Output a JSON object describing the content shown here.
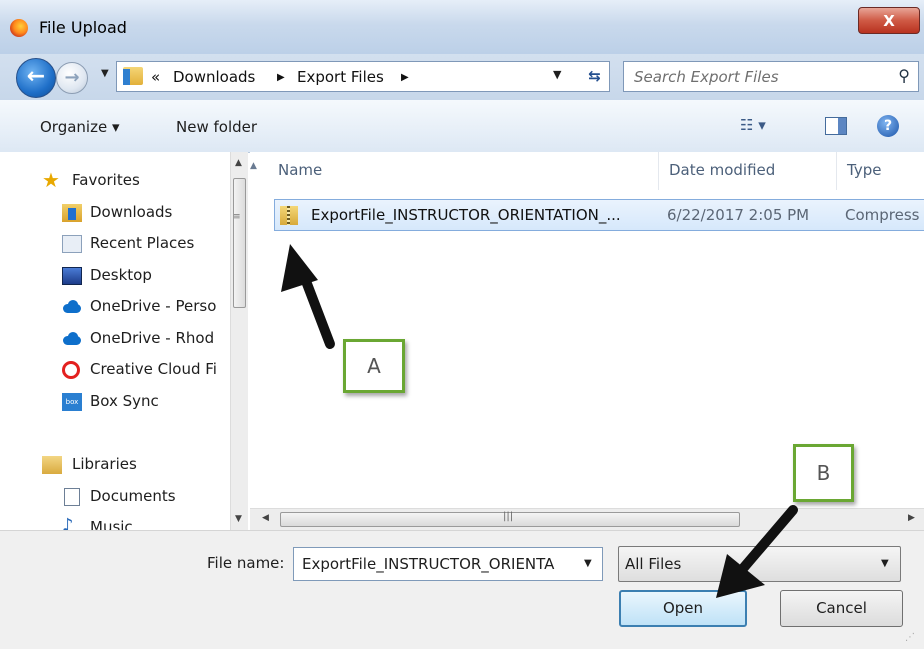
{
  "window": {
    "title": "File Upload",
    "close_label": "X"
  },
  "nav": {
    "back_icon": "back-arrow-icon",
    "forward_icon": "forward-arrow-icon",
    "breadcrumb_overflow": "«",
    "breadcrumb": [
      "Downloads",
      "Export Files"
    ],
    "search_placeholder": "Search Export Files"
  },
  "toolbar": {
    "organize_label": "Organize ▾",
    "new_folder_label": "New folder"
  },
  "sidebar": {
    "favorites_label": "Favorites",
    "items": [
      {
        "label": "Downloads",
        "icon": "downloads-folder-icon"
      },
      {
        "label": "Recent Places",
        "icon": "recent-places-icon"
      },
      {
        "label": "Desktop",
        "icon": "desktop-icon"
      },
      {
        "label": "OneDrive - Perso",
        "icon": "onedrive-cloud-icon"
      },
      {
        "label": "OneDrive - Rhod",
        "icon": "onedrive-cloud-icon"
      },
      {
        "label": "Creative Cloud Fi",
        "icon": "creative-cloud-icon"
      },
      {
        "label": "Box Sync",
        "icon": "box-icon"
      }
    ],
    "libraries_label": "Libraries",
    "library_items": [
      {
        "label": "Documents",
        "icon": "document-icon"
      },
      {
        "label": "Music",
        "icon": "music-note-icon"
      }
    ],
    "box_icon_text": "box"
  },
  "file_list": {
    "columns": [
      "Name",
      "Date modified",
      "Type"
    ],
    "rows": [
      {
        "name": "ExportFile_INSTRUCTOR_ORIENTATION_...",
        "date": "6/22/2017 2:05 PM",
        "type": "Compress"
      }
    ]
  },
  "footer": {
    "file_name_label": "File name:",
    "file_name_value": "ExportFile_INSTRUCTOR_ORIENTA",
    "filter_value": "All Files",
    "open_label": "Open",
    "cancel_label": "Cancel"
  },
  "annotations": {
    "callout_a": "A",
    "callout_b": "B",
    "arrow_color": "#111111",
    "callout_border_color": "#6aa733"
  },
  "colors": {
    "selection_fill": "#d6e8fb",
    "selection_border": "#84acdd",
    "close_button": "#cf5a45"
  }
}
